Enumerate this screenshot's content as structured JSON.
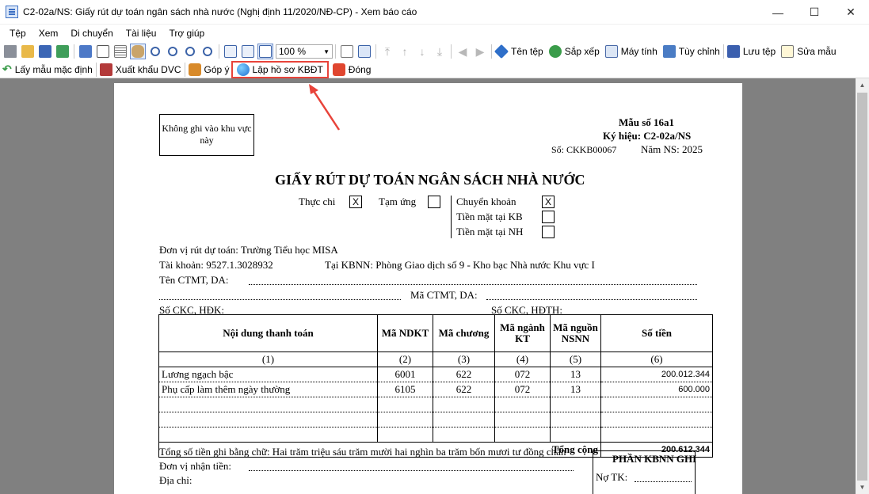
{
  "window": {
    "title": "C2-02a/NS: Giấy rút dự toán ngân sách nhà nước (Nghị định 11/2020/NĐ-CP) - Xem báo cáo",
    "minimize": "—",
    "maximize": "☐",
    "close": "✕"
  },
  "menu": [
    "Tệp",
    "Xem",
    "Di chuyển",
    "Tài liệu",
    "Trợ giúp"
  ],
  "toolbar1": {
    "zoom": "100 %",
    "file_name": "Tên tệp",
    "sort": "Sắp xếp",
    "calculator": "Máy tính",
    "customize": "Tùy chỉnh",
    "save_file": "Lưu tệp",
    "edit_template": "Sửa mẫu"
  },
  "toolbar2": {
    "default_template": "Lấy mẫu mặc định",
    "export_dvc": "Xuất khẩu DVC",
    "feedback": "Góp ý",
    "create_kbdt": "Lập hồ sơ KBĐT",
    "close": "Đóng"
  },
  "colors": {
    "highlight": "#e8433a",
    "workarea": "#808080"
  },
  "form": {
    "no_write_box": "Không ghi vào khu vực này",
    "form_no": "Mẫu số 16a1",
    "code": "Ký hiệu: C2-02a/NS",
    "doc_no": "Số: CKKB00067",
    "year": "Năm NS: 2025",
    "title": "GIẤY RÚT DỰ TOÁN NGÂN SÁCH NHÀ NƯỚC",
    "actual_spend": "Thực chi",
    "actual_spend_mark": "X",
    "advance": "Tạm ứng",
    "advance_mark": "",
    "transfer": "Chuyển khoản",
    "transfer_mark": "X",
    "cash_kb": "Tiền mặt tại KB",
    "cash_kb_mark": "",
    "cash_nh": "Tiền mặt tại NH",
    "cash_nh_mark": "",
    "unit": "Đơn vị rút dự toán: Trường Tiểu học MISA",
    "account": "Tài khoản: 9527.1.3028932",
    "at_kbnn": "Tại KBNN: Phòng Giao dịch số 9 - Kho bạc Nhà nước Khu vực I",
    "ctmt_name": "Tên CTMT, DA:",
    "ctmt_code": "Mã CTMT, DA:",
    "ckc_hdk": "Số CKC, HĐK:",
    "ckc_hdth": "Số CKC, HĐTH:",
    "headers": [
      "Nội dung thanh toán",
      "Mã NDKT",
      "Mã chương",
      "Mã ngành KT",
      "Mã nguồn NSNN",
      "Số tiền"
    ],
    "index_row": [
      "(1)",
      "(2)",
      "(3)",
      "(4)",
      "(5)",
      "(6)"
    ],
    "rows": [
      {
        "content": "Lương ngạch bậc",
        "ndkt": "6001",
        "chapter": "622",
        "industry": "072",
        "source": "13",
        "amount": "200.012.344"
      },
      {
        "content": "Phụ cấp làm thêm ngày thường",
        "ndkt": "6105",
        "chapter": "622",
        "industry": "072",
        "source": "13",
        "amount": "600.000"
      }
    ],
    "total_label": "Tổng cộng",
    "total_amount": "200.612.344",
    "in_words": "Tổng số tiền ghi bằng chữ: Hai trăm triệu sáu trăm mười hai nghìn ba trăm bốn mươi tư đồng chẵn",
    "receiver": "Đơn vị nhận tiền:",
    "address": "Địa chỉ:",
    "kbnn_section": "PHẦN KBNN GHI",
    "debit": "Nợ TK:"
  }
}
